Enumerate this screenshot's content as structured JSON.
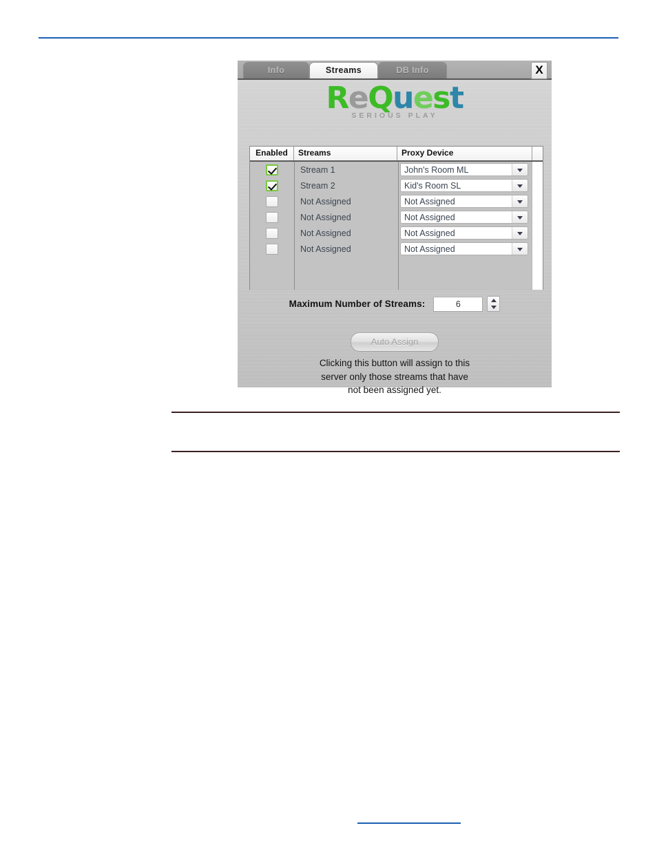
{
  "document": {
    "top_rule_color": "#1a5fb4",
    "note_rule_color": "#3b1f20",
    "bottom_rule_color": "#1a5fb4"
  },
  "dialog": {
    "close_label": "X",
    "tabs": [
      {
        "label": "Info",
        "active": false
      },
      {
        "label": "Streams",
        "active": true
      },
      {
        "label": "DB Info",
        "active": false
      }
    ],
    "logo": {
      "letters": [
        {
          "char": "R",
          "color": "#3dbb27"
        },
        {
          "char": "e",
          "color": "#9a9a9a"
        },
        {
          "char": "Q",
          "color": "#3dbb27"
        },
        {
          "char": "u",
          "color": "#2e86a8"
        },
        {
          "char": "e",
          "color": "#6fce5a"
        },
        {
          "char": "s",
          "color": "#3dbb27"
        },
        {
          "char": "t",
          "color": "#2e86a8"
        }
      ],
      "full_text": "ReQuest",
      "tagline": "SERIOUS PLAY"
    },
    "table": {
      "headers": {
        "enabled": "Enabled",
        "streams": "Streams",
        "proxy": "Proxy Device"
      },
      "rows": [
        {
          "enabled": true,
          "stream": "Stream 1",
          "proxy": "John's Room ML"
        },
        {
          "enabled": true,
          "stream": "Stream 2",
          "proxy": "Kid's Room SL"
        },
        {
          "enabled": false,
          "stream": "Not Assigned",
          "proxy": "Not Assigned"
        },
        {
          "enabled": false,
          "stream": "Not Assigned",
          "proxy": "Not Assigned"
        },
        {
          "enabled": false,
          "stream": "Not Assigned",
          "proxy": "Not Assigned"
        },
        {
          "enabled": false,
          "stream": "Not Assigned",
          "proxy": "Not Assigned"
        }
      ]
    },
    "max_streams": {
      "label": "Maximum Number of Streams:",
      "value": "6"
    },
    "auto_assign": {
      "label": "Auto Assign",
      "enabled": false
    },
    "description": {
      "line1": "Clicking this button will assign to this",
      "line2": "server only those streams that have",
      "line3": "not been assigned yet."
    }
  }
}
